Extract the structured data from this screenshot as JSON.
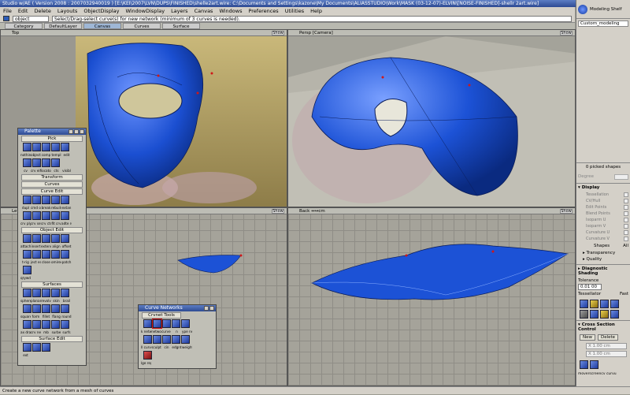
{
  "window": {
    "title": "Studio w/AE ( Version 2008 : 2007032940019 ) [E:\\KEI\\2007\\LVN\\DUPS\\FINISHED\\shelle2art.wire: C:\\Documents and Settings\\kazone\\My Documents\\ALIASSTUDIO\\Work\\MASK (03-12-07)-ELVIN\\[NOISE-FINISHED]-shellr 2art.wire]"
  },
  "menu": [
    "File",
    "Edit",
    "Delete",
    "Layouts",
    "ObjectDisplay",
    "WindowDisplay",
    "Layers",
    "Canvas",
    "Windows",
    "Preferences",
    "Utilities",
    "Help"
  ],
  "pickbar": {
    "mode_value": "object",
    "prompt": "Select/Drag-select curve(s) for new network (minimum of 3 curves is needed)."
  },
  "shelf_tabs": [
    "Category",
    "DefaultLayer",
    "Canvas",
    "Curves",
    "Surface"
  ],
  "viewports": {
    "top": {
      "label": "Top",
      "show": "Show"
    },
    "persp": {
      "label": "Persp [Camera]",
      "show": "Show"
    },
    "left": {
      "label": "Left",
      "show": "Show"
    },
    "back": {
      "label": "Back ↔↔cm",
      "show": "Show"
    }
  },
  "right_panel": {
    "header_title": "Modeling Shelf",
    "shelf_tab": "Custom_modeling",
    "picked": "0 picked shapes",
    "degree_label": "Degree",
    "display_title": "Display",
    "display_items": [
      "Tessellation",
      "CV/Hull",
      "Edit Points",
      "Blend Points",
      "Isoparm U",
      "Isoparm V",
      "Curvature U",
      "Curvature V"
    ],
    "shapes_label": "Shapes",
    "all_label": "All",
    "transparency": "Transparency",
    "quality": "Quality",
    "diag_title": "Diagnostic Shading",
    "tolerance_label": "Tolerance",
    "tolerance_value": "0.01 00",
    "tessellator_label": "Tessellator",
    "tessellator_value": "Fast",
    "cross_title": "Cross Section Control",
    "new_btn": "New",
    "delete_btn": "Delete",
    "x_value": "X 1.00 cm",
    "y_value": "X 1.00 cm",
    "bottom_icon_label": "moverscreencv curvu"
  },
  "palette": {
    "title": "Palette",
    "sections": [
      {
        "name": "Pick",
        "rows": [
          [
            "blue",
            "blue",
            "blue",
            "blue",
            "blue"
          ],
          [
            "blue",
            "blue",
            "blue",
            "blue"
          ]
        ],
        "labels": [
          [
            "nothing",
            "object",
            "comp",
            "templ",
            "edit"
          ],
          [
            "cv",
            "crv eif",
            "locator",
            "cts",
            "visibl"
          ]
        ]
      },
      {
        "name": "Transform",
        "rows": [],
        "labels": []
      },
      {
        "name": "Curves",
        "rows": [],
        "labels": []
      },
      {
        "name": "Curve Edit",
        "rows": [
          [
            "blue",
            "blue",
            "blue",
            "blue",
            "blue"
          ],
          [
            "blue",
            "blue",
            "blue",
            "blue",
            "blue"
          ]
        ],
        "labels": [
          [
            "dupl",
            "cmd or",
            "break",
            "rebuild",
            "extan"
          ],
          [
            "crv ply",
            "crv set",
            "crv cts",
            "fit crv",
            "adte rev"
          ]
        ]
      },
      {
        "name": "Object Edit",
        "rows": [
          [
            "blue",
            "blue",
            "blue",
            "blue",
            "blue"
          ],
          [
            "blue",
            "blue",
            "blue",
            "blue",
            "blue"
          ]
        ],
        "labels": [
          [
            "attach",
            "insert",
            "extend",
            "align",
            "offset"
          ],
          [
            "t-rig",
            "ject edit",
            "close",
            "omireen",
            "patch"
          ]
        ]
      },
      {
        "name": "",
        "rows": [
          [
            "blue"
          ]
        ],
        "labels": [
          [
            "qrywdt"
          ]
        ]
      },
      {
        "name": "Surfaces",
        "rows": [
          [
            "blue",
            "blue",
            "blue",
            "blue",
            "blue"
          ],
          [
            "blue",
            "blue",
            "blue",
            "blue",
            "blue"
          ],
          [
            "blue",
            "blue",
            "blue",
            "blue",
            "blue"
          ]
        ],
        "labels": [
          [
            "sphere",
            "planar",
            "revolve",
            "skin",
            "brail"
          ],
          [
            "squareface fillet",
            "form",
            "fillet",
            "flang",
            "round"
          ],
          [
            "ax draft",
            "crv net",
            "mb",
            "surbe",
            "surfs"
          ]
        ]
      },
      {
        "name": "Surface Edit",
        "rows": [
          [
            "blue",
            "blue",
            "blue"
          ]
        ],
        "labels": [
          [
            "ext",
            "",
            ""
          ]
        ]
      }
    ]
  },
  "curve_networks": {
    "title": "Curve Networks",
    "tab": "Crvnet Tools",
    "labels1": [
      "k network",
      "network",
      "curve to",
      "n",
      "ype net"
    ],
    "labels2": [
      "ll curves",
      "sculpt",
      "cin",
      "edgnt",
      "weightenes"
    ],
    "bottom_label": "lge regs"
  },
  "status": "Create a new curve network from a mesh of curves"
}
